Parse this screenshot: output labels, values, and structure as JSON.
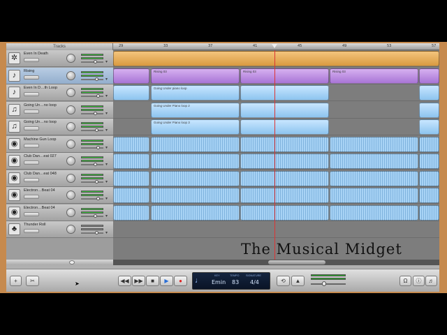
{
  "header": {
    "tracks_label": "Tracks"
  },
  "ruler": {
    "ticks": [
      "29",
      "",
      "33",
      "",
      "37",
      "",
      "41",
      "",
      "45",
      "",
      "49",
      "",
      "53",
      "",
      "57"
    ]
  },
  "tracks": [
    {
      "name": "Even In Death",
      "icon": "speaker-icon",
      "glyph": "✲",
      "selected": false
    },
    {
      "name": "Rising",
      "icon": "guitar-icon",
      "glyph": "♪",
      "selected": true
    },
    {
      "name": "Even In D…th Loop",
      "icon": "guitar-icon",
      "glyph": "♪",
      "selected": false
    },
    {
      "name": "Going Un…no loop",
      "icon": "piano-icon",
      "glyph": "♫",
      "selected": false
    },
    {
      "name": "Going Un…no loop",
      "icon": "piano-icon",
      "glyph": "♫",
      "selected": false
    },
    {
      "name": "Machine Gun Loop",
      "icon": "drum-icon",
      "glyph": "◉",
      "selected": false
    },
    {
      "name": "Club Dan…eat 027",
      "icon": "drum-icon",
      "glyph": "◉",
      "selected": false
    },
    {
      "name": "Club Dan…eat 048",
      "icon": "drum-icon",
      "glyph": "◉",
      "selected": false
    },
    {
      "name": "Electron…Beat 04",
      "icon": "drum-icon",
      "glyph": "◉",
      "selected": false
    },
    {
      "name": "Electron…Beat 04",
      "icon": "drum-icon",
      "glyph": "◉",
      "selected": false
    },
    {
      "name": "Thunder Roll",
      "icon": "palm-tree-icon",
      "glyph": "♣",
      "selected": false
    }
  ],
  "regions": {
    "rising_1": "Rising 03",
    "rising_2": "Rising 03",
    "rising_3": "Rising 03",
    "even_loop": "Going Under piano loop",
    "going_1": "Going Under Piano loop 2",
    "going_2": "Going Under Piano loop 3"
  },
  "watermark": "The Musical Midget",
  "transport": {
    "lcd_key_caption": "KEY",
    "lcd_tempo_caption": "TEMPO",
    "lcd_sig_caption": "SIGNATURE",
    "key": "Emin",
    "tempo": "83",
    "signature": "4/4"
  },
  "colors": {
    "window_border": "#c68a4e",
    "playhead": "#dd3333"
  }
}
